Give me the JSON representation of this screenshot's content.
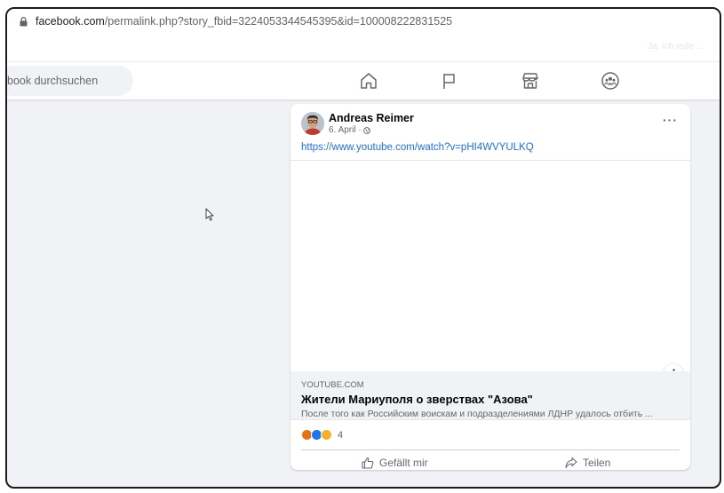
{
  "browser": {
    "url_host": "facebook.com",
    "url_rest": "/permalink.php?story_fbid=3224053344545395&id=100008222831525",
    "bookmark_faint_text": "Ja, ich rede ..."
  },
  "fb_nav": {
    "search_placeholder": "book durchsuchen",
    "icons": [
      "home-icon",
      "flag-icon",
      "marketplace-icon",
      "groups-icon"
    ]
  },
  "post": {
    "author": "Andreas Reimer",
    "date": "6. April · ",
    "more_label": "···",
    "link_url": "https://www.youtube.com/watch?v=pHI4WVYULKQ",
    "preview": {
      "domain": "YOUTUBE.COM",
      "title": "Жители Мариуполя о зверствах \"Азова\"",
      "description": "После того как Российским воискам и подразделениями ЛДНР удалось отбить ...",
      "info_label": "i"
    },
    "reactions": {
      "types": [
        "angry",
        "like",
        "haha"
      ],
      "count": "4"
    },
    "actions": {
      "like": "Gefällt mir",
      "share": "Teilen"
    }
  },
  "colors": {
    "fb_blue": "#216fdb",
    "bg": "#f0f2f5",
    "secondary_text": "#65676b"
  }
}
